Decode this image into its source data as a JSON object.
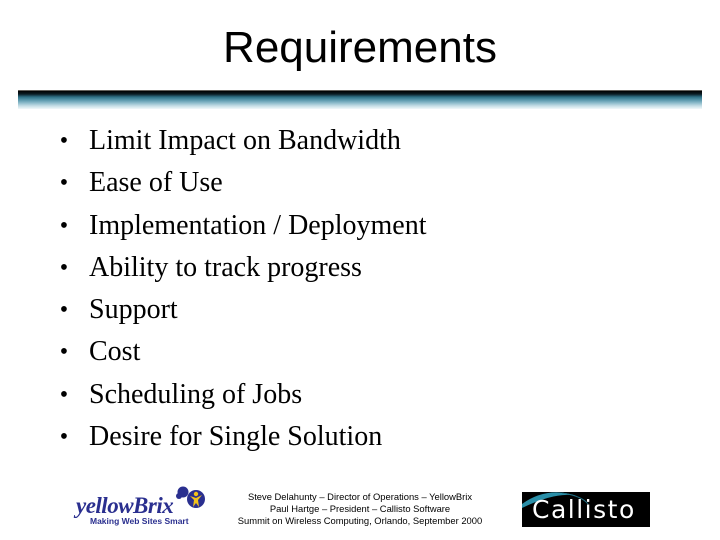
{
  "slide": {
    "title": "Requirements",
    "bullet_glyph": "•",
    "bullets": [
      "Limit Impact on Bandwidth",
      "Ease of Use",
      "Implementation / Deployment",
      "Ability to track progress",
      "Support",
      "Cost",
      "Scheduling of Jobs",
      "Desire for Single Solution"
    ]
  },
  "footer": {
    "lines": [
      "Steve Delahunty – Director of Operations – YellowBrix",
      "Paul Hartge – President – Callisto Software",
      "Summit on Wireless Computing, Orlando, September 2000"
    ],
    "left_logo": {
      "name": "yellowBrix",
      "tagline": "Making Web Sites Smart",
      "colors": {
        "navy": "#2a2f8f",
        "yellow": "#f2c21b"
      }
    },
    "right_logo": {
      "name": "Callisto",
      "colors": {
        "background": "#000000",
        "accent": "#2a8fa8",
        "text": "#ffffff"
      }
    }
  },
  "colors": {
    "rule_dark": "#000000",
    "rule_teal": "#2f6f84"
  }
}
